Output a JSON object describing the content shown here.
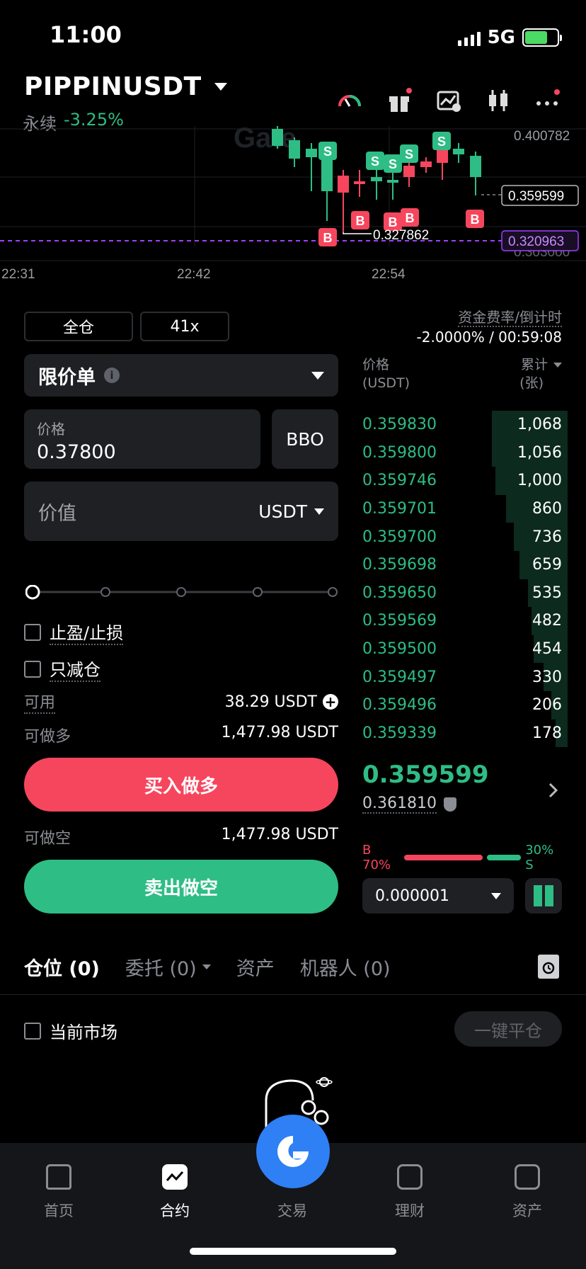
{
  "status": {
    "time": "11:00",
    "network": "5G"
  },
  "header": {
    "symbol": "PIPPINUSDT",
    "contract_type": "永续",
    "change": "-3.25%"
  },
  "chart": {
    "watermark": "Gate",
    "y_labels": {
      "top": "0.400782",
      "current": "0.359599",
      "low_marker": "0.327862",
      "dashed": "0.320963",
      "bottom": "0.303000"
    },
    "time_labels": [
      "22:31",
      "22:42",
      "22:54"
    ],
    "markers": {
      "sell": "S",
      "buy": "B"
    }
  },
  "order": {
    "margin_mode": "全仓",
    "leverage": "41x",
    "funding_label": "资金费率/倒计时",
    "funding_value": "-2.0000% / 00:59:08",
    "order_type": "限价单",
    "price_label": "价格",
    "price_value": "0.37800",
    "bbo": "BBO",
    "value_label": "价值",
    "value_unit": "USDT",
    "tpsl": "止盈/止损",
    "reduce_only": "只减仓",
    "available_label": "可用",
    "available_value": "38.29 USDT",
    "long_label": "可做多",
    "long_value": "1,477.98 USDT",
    "buy_button": "买入做多",
    "short_label": "可做空",
    "short_value": "1,477.98 USDT",
    "sell_button": "卖出做空"
  },
  "orderbook": {
    "price_header": "价格",
    "price_unit": "(USDT)",
    "qty_header": "累计",
    "qty_unit": "(张)",
    "rows": [
      {
        "price": "0.359830",
        "qty": "1,068",
        "depth": 0.38
      },
      {
        "price": "0.359800",
        "qty": "1,056",
        "depth": 0.38
      },
      {
        "price": "0.359746",
        "qty": "1,000",
        "depth": 0.36
      },
      {
        "price": "0.359701",
        "qty": "860",
        "depth": 0.31
      },
      {
        "price": "0.359700",
        "qty": "736",
        "depth": 0.27
      },
      {
        "price": "0.359698",
        "qty": "659",
        "depth": 0.24
      },
      {
        "price": "0.359650",
        "qty": "535",
        "depth": 0.2
      },
      {
        "price": "0.359569",
        "qty": "482",
        "depth": 0.18
      },
      {
        "price": "0.359500",
        "qty": "454",
        "depth": 0.17
      },
      {
        "price": "0.359497",
        "qty": "330",
        "depth": 0.12
      },
      {
        "price": "0.359496",
        "qty": "206",
        "depth": 0.08
      },
      {
        "price": "0.359339",
        "qty": "178",
        "depth": 0.06
      }
    ],
    "last_price": "0.359599",
    "mark_price": "0.361810",
    "buy_ratio": "B 70%",
    "sell_ratio": "30% S",
    "buy_pct": 70,
    "sell_pct": 30,
    "precision": "0.000001"
  },
  "tabs": {
    "positions": "仓位 (0)",
    "orders": "委托 (0)",
    "assets": "资产",
    "bots": "机器人 (0)",
    "current_market": "当前市场",
    "close_all": "一键平仓"
  },
  "nav": {
    "home": "首页",
    "futures": "合约",
    "trade": "交易",
    "earn": "理财",
    "assets": "资产"
  },
  "colors": {
    "buy": "#2ebd85",
    "sell": "#f6465d",
    "dashed_line": "#a040ff"
  }
}
